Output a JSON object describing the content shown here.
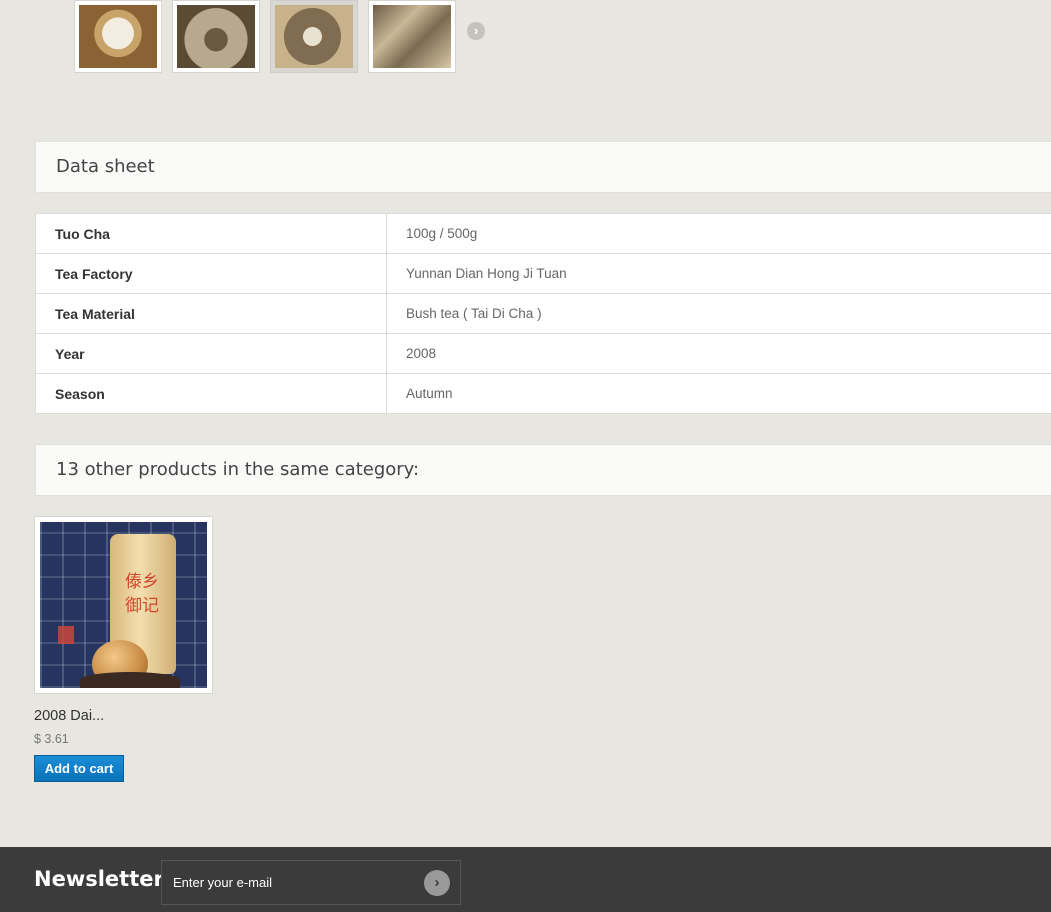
{
  "thumbnails": {
    "items": [
      {
        "alt": "tuo-cha-wrapper"
      },
      {
        "alt": "tuo-cha-underside"
      },
      {
        "alt": "tuo-cha-top"
      },
      {
        "alt": "tuo-cha-leaves"
      }
    ],
    "next_icon": "chevron-right-icon",
    "next_glyph": "›"
  },
  "datasheet": {
    "title": "Data sheet",
    "rows": [
      {
        "key": "Tuo Cha",
        "value": "100g / 500g"
      },
      {
        "key": "Tea Factory",
        "value": "Yunnan Dian Hong Ji Tuan"
      },
      {
        "key": "Tea Material",
        "value": "Bush tea ( Tai Di Cha )"
      },
      {
        "key": "Year",
        "value": "2008"
      },
      {
        "key": "Season",
        "value": "Autumn"
      }
    ]
  },
  "related": {
    "title": "13 other products in the same category:",
    "products": [
      {
        "name": "2008 Dai...",
        "price": "$ 3.61",
        "button": "Add to cart",
        "image_text": "傣乡御记"
      }
    ]
  },
  "newsletter": {
    "title": "Newsletter",
    "placeholder": "Enter your e-mail",
    "submit_glyph": "›",
    "submit_icon": "chevron-right-icon"
  },
  "colors": {
    "accent": "#0a72b8",
    "footer_bg": "#3b3b3b",
    "page_bg": "#e8e6e0"
  }
}
